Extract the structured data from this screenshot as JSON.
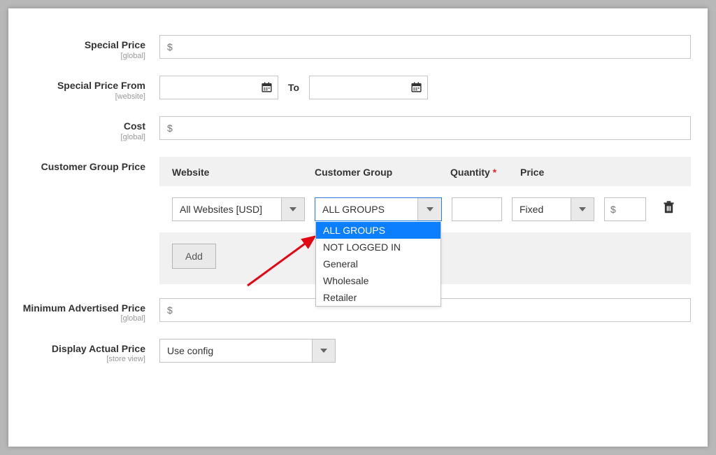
{
  "fields": {
    "special_price": {
      "label": "Special Price",
      "scope": "[global]",
      "prefix": "$"
    },
    "special_from": {
      "label": "Special Price From",
      "scope": "[website]",
      "to": "To"
    },
    "cost": {
      "label": "Cost",
      "scope": "[global]",
      "prefix": "$"
    },
    "group_price": {
      "label": "Customer Group Price"
    },
    "map": {
      "label": "Minimum Advertised Price",
      "scope": "[global]",
      "prefix": "$"
    },
    "display_price": {
      "label": "Display Actual Price",
      "scope": "[store view]",
      "value": "Use config"
    }
  },
  "group_headers": {
    "website": "Website",
    "group": "Customer Group",
    "qty": "Quantity",
    "price": "Price"
  },
  "group_row": {
    "website": "All Websites [USD]",
    "group_selected": "ALL GROUPS",
    "fixed": "Fixed",
    "price_prefix": "$"
  },
  "group_options": [
    "ALL GROUPS",
    "NOT LOGGED IN",
    "General",
    "Wholesale",
    "Retailer"
  ],
  "add_button": "Add"
}
